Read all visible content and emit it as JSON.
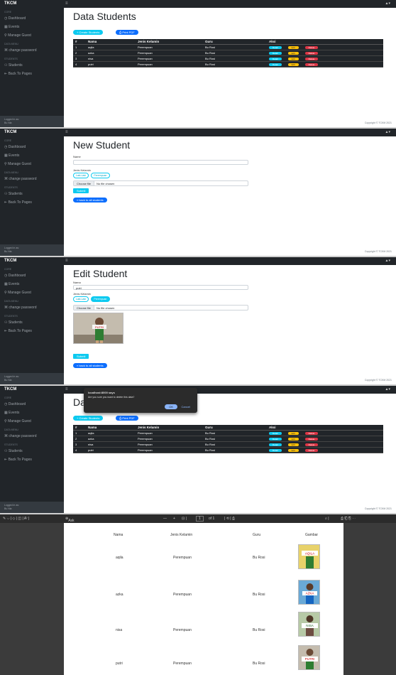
{
  "brand": "TKCM",
  "user_icon": "▲▾",
  "sidebar": {
    "core": "CORE",
    "items": [
      "Dashboard",
      "Events",
      "Manage Guest"
    ],
    "sec2": "DATA MENU",
    "pass": "change password",
    "sec3": "STUDENTS",
    "students": "Students",
    "back": "Back To Pages",
    "logged": "Logged in as:",
    "who": "Bu Nia"
  },
  "copyright": "Copyright © TCKM 2021",
  "list": {
    "title": "Data Students",
    "create": "+ Create Students",
    "print": "Print PDF",
    "headers": [
      "#",
      "Nama",
      "Jenis Kelamin",
      "Guru",
      "Aksi"
    ],
    "rows": [
      {
        "no": "1",
        "nama": "aqila",
        "jk": "Perempuan",
        "guru": "Bu Rosi"
      },
      {
        "no": "2",
        "nama": "azka",
        "jk": "Perempuan",
        "guru": "Bu Rosi"
      },
      {
        "no": "3",
        "nama": "nisa",
        "jk": "Perempuan",
        "guru": "Bu Rosi"
      },
      {
        "no": "4",
        "nama": "putri",
        "jk": "Perempuan",
        "guru": "Bu Rosi"
      }
    ],
    "detail": "Detail",
    "edit": "Edit",
    "delete": "Delete"
  },
  "new_form": {
    "title": "New Student",
    "name_label": "Name",
    "name_value": "",
    "jk_label": "Jenis Kelamin",
    "opt1": "Laki-Laki",
    "opt2": "Perempuan",
    "choose": "Choose file",
    "nofile": "No file chosen",
    "submit": "Submit",
    "back": "« back to all students"
  },
  "edit_form": {
    "title": "Edit Student",
    "name_label": "Nama",
    "name_value": "putri",
    "jk_label": "Jenis Kelamin",
    "opt1": "Laki-Laki",
    "opt2": "Perempuan",
    "choose": "Choose file",
    "nofile": "No file chosen",
    "photo_text": "PUTRI",
    "submit": "Submit",
    "back": "« back to all students"
  },
  "dialog": {
    "title": "localhost:8000 says",
    "message": "Are you sure you want to delete this data?",
    "ok": "OK",
    "cancel": "Cancel"
  },
  "pdf": {
    "toolbar": [
      "Ask Copilot",
      "+",
      "1",
      "of 1"
    ],
    "headers": [
      "Nama",
      "Jenis Kelamin",
      "Guru",
      "Gambar"
    ],
    "rows": [
      {
        "nama": "aqila",
        "jk": "Perempuan",
        "guru": "Bu Rosi",
        "img": "AQILA"
      },
      {
        "nama": "azka",
        "jk": "Perempuan",
        "guru": "Bu Rosi",
        "img": "AZKA"
      },
      {
        "nama": "nisa",
        "jk": "Perempuan",
        "guru": "Bu Rosi",
        "img": "NISA"
      },
      {
        "nama": "putri",
        "jk": "Perempuan",
        "guru": "Bu Rosi",
        "img": "PUTRI"
      }
    ]
  }
}
